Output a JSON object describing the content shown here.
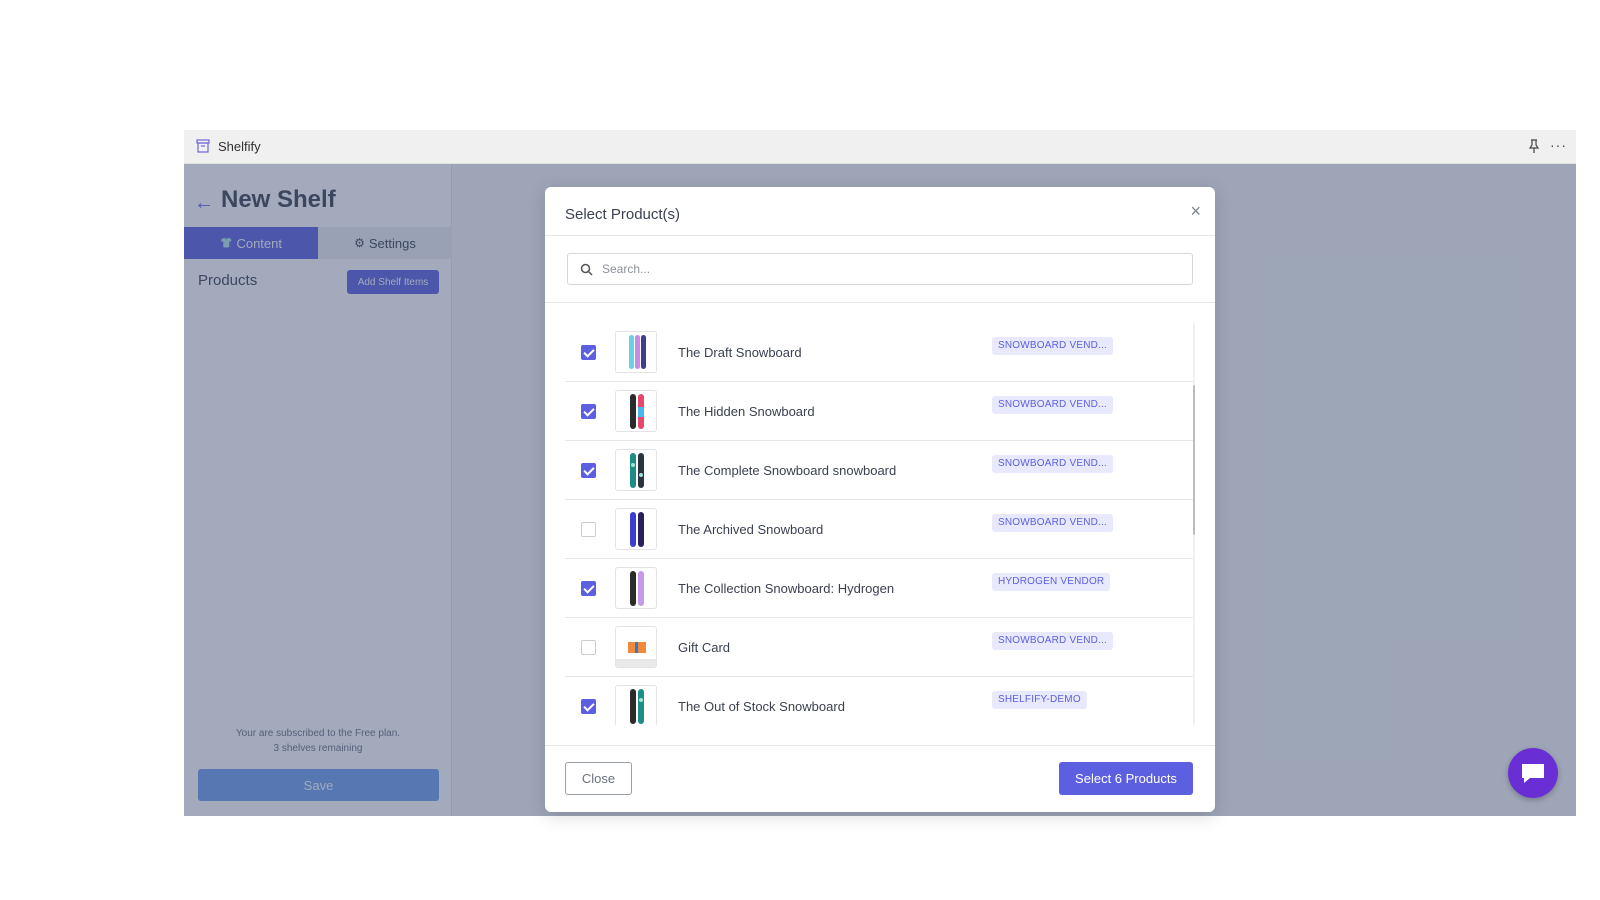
{
  "app": {
    "name": "Shelfify",
    "icon": "archive-box-icon",
    "titlebar_icons": [
      "pin-icon",
      "more-horizontal-icon"
    ],
    "more_label": "···"
  },
  "sidebar": {
    "back_icon": "←",
    "title": "New Shelf",
    "tabs": [
      {
        "label": "Content",
        "icon": "👕",
        "active": true
      },
      {
        "label": "Settings",
        "icon": "⚙",
        "active": false
      }
    ],
    "products_label": "Products",
    "add_button": "Add Shelf Items",
    "plan_line1": "Your are subscribed to the Free plan.",
    "plan_line2": "3 shelves remaining",
    "save_button": "Save"
  },
  "modal": {
    "title": "Select Product(s)",
    "close_icon": "×",
    "search_placeholder": "Search...",
    "search_value": "",
    "products": [
      {
        "name": "The Draft Snowboard",
        "vendor": "SNOWBOARD VEND...",
        "checked": true
      },
      {
        "name": "The Hidden Snowboard",
        "vendor": "SNOWBOARD VEND...",
        "checked": true
      },
      {
        "name": "The Complete Snowboard   snowboard",
        "vendor": "SNOWBOARD VEND...",
        "checked": true
      },
      {
        "name": "The Archived Snowboard",
        "vendor": "SNOWBOARD VEND...",
        "checked": false
      },
      {
        "name": "The Collection Snowboard: Hydrogen",
        "vendor": "HYDROGEN VENDOR",
        "checked": true
      },
      {
        "name": "Gift Card",
        "vendor": "SNOWBOARD VEND...",
        "checked": false
      },
      {
        "name": "The Out of Stock Snowboard",
        "vendor": "SHELFIFY-DEMO",
        "checked": true
      }
    ],
    "close_button": "Close",
    "select_button": "Select 6 Products"
  },
  "colors": {
    "accent": "#5b5fe0",
    "overlay": "#3d4e70",
    "chat": "#6a2fd4",
    "save": "#6f9ef0"
  }
}
